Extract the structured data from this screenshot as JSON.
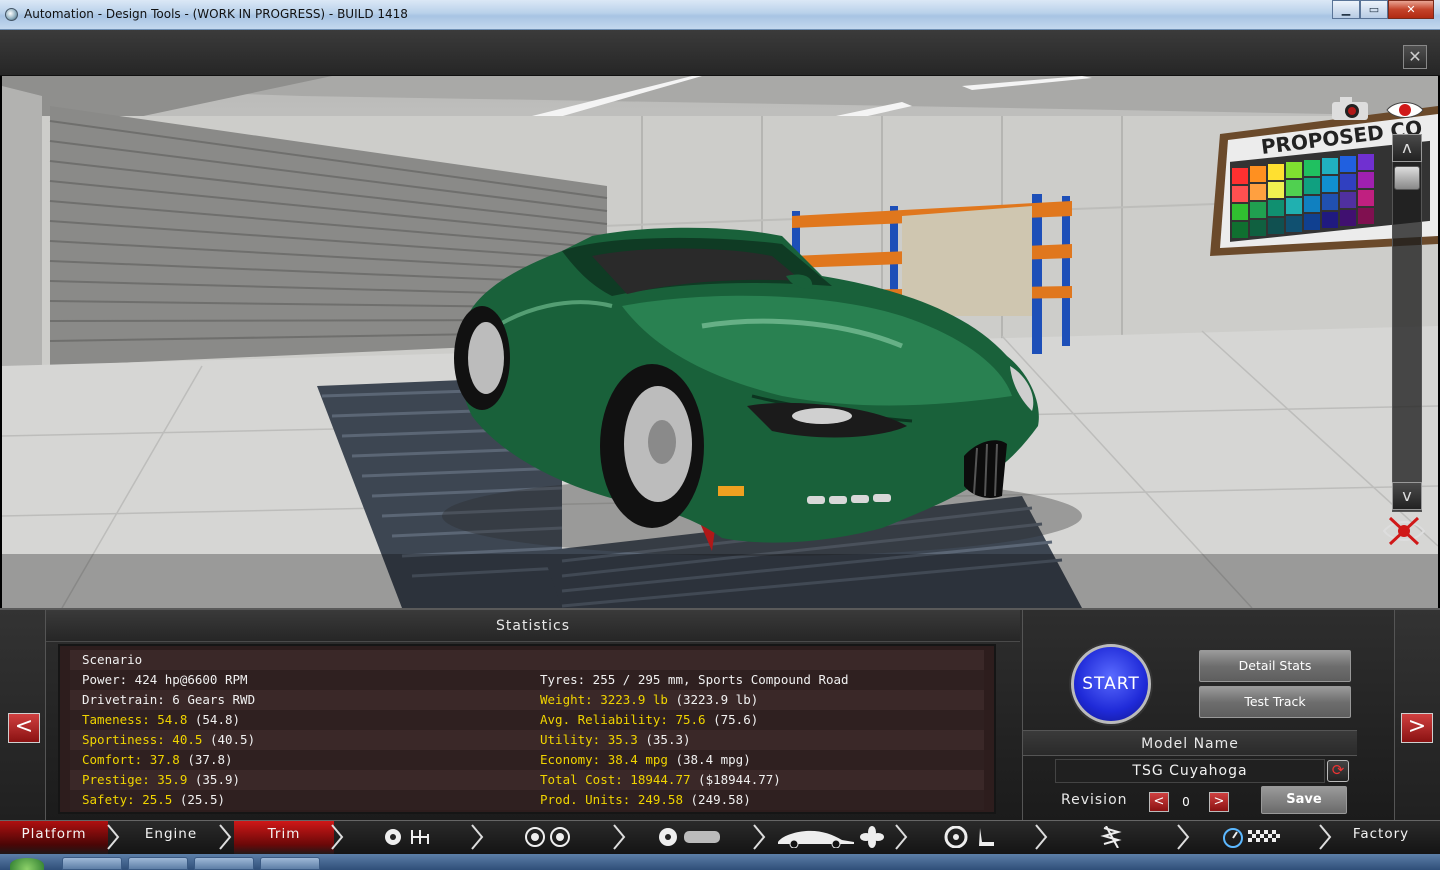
{
  "window": {
    "title": "Automation - Design Tools - (WORK IN PROGRESS) - BUILD 1418",
    "minimize": "▁",
    "maximize": "▭",
    "close": "✕"
  },
  "toolbar": {
    "close_label": "✕"
  },
  "viewport": {
    "poster_text": "PROPOSED CO",
    "car_color": "#1a6b3e",
    "scroll_up": "ʌ",
    "scroll_down": "v",
    "icons": [
      "camera-icon",
      "eye-icon",
      "hide-view-icon"
    ]
  },
  "statistics": {
    "title": "Statistics",
    "left_arrow": "<",
    "right_arrow": ">",
    "rows": [
      {
        "left": {
          "label": "Scenario",
          "value": "",
          "highlight": false
        },
        "right": {
          "label": "",
          "value": "",
          "highlight": false
        }
      },
      {
        "left": {
          "label": "Power: 424 hp@6600 RPM",
          "value": "",
          "highlight": false
        },
        "right": {
          "label": "Tyres: 255 / 295 mm, Sports Compound Road",
          "value": "",
          "highlight": false
        }
      },
      {
        "left": {
          "label": "Drivetrain: 6 Gears RWD",
          "value": "",
          "highlight": false
        },
        "right": {
          "label": "Weight: 3223.9 lb",
          "value": " (3223.9 lb)",
          "highlight": true
        }
      },
      {
        "left": {
          "label": "Tameness: 54.8",
          "value": " (54.8)",
          "highlight": true
        },
        "right": {
          "label": "Avg. Reliability: 75.6",
          "value": " (75.6)",
          "highlight": true
        }
      },
      {
        "left": {
          "label": "Sportiness: 40.5",
          "value": " (40.5)",
          "highlight": true
        },
        "right": {
          "label": "Utility: 35.3",
          "value": " (35.3)",
          "highlight": true
        }
      },
      {
        "left": {
          "label": "Comfort: 37.8",
          "value": " (37.8)",
          "highlight": true
        },
        "right": {
          "label": "Economy: 38.4 mpg",
          "value": " (38.4 mpg)",
          "highlight": true
        }
      },
      {
        "left": {
          "label": "Prestige: 35.9",
          "value": " (35.9)",
          "highlight": true
        },
        "right": {
          "label": "Total Cost: 18944.77",
          "value": " ($18944.77)",
          "highlight": true
        }
      },
      {
        "left": {
          "label": "Safety: 25.5",
          "value": " (25.5)",
          "highlight": true
        },
        "right": {
          "label": "Prod. Units: 249.58",
          "value": " (249.58)",
          "highlight": true
        }
      }
    ]
  },
  "actions": {
    "start": "START",
    "detail_stats": "Detail Stats",
    "test_track": "Test Track",
    "model_name_label": "Model Name",
    "model_name_value": "TSG Cuyahoga",
    "revision_label": "Revision",
    "revision_value": "0",
    "rev_prev": "<",
    "rev_next": ">",
    "save": "Save"
  },
  "nav": {
    "tabs": [
      {
        "label": "Platform",
        "active": false
      },
      {
        "label": "Engine",
        "active": false
      },
      {
        "label": "Trim",
        "active": true
      },
      {
        "label": "",
        "icon": "gearbox-icon"
      },
      {
        "label": "",
        "icon": "wheels-icon"
      },
      {
        "label": "",
        "icon": "brakes-icon"
      },
      {
        "label": "",
        "icon": "aero-icon"
      },
      {
        "label": "",
        "icon": "interior-icon"
      },
      {
        "label": "",
        "icon": "suspension-icon"
      },
      {
        "label": "",
        "icon": "testing-icon"
      },
      {
        "label": "Factory",
        "active": false
      }
    ]
  },
  "colors": {
    "highlight": "#f0d400",
    "accent_red": "#c01818",
    "start_blue": "#1f2ad8"
  }
}
